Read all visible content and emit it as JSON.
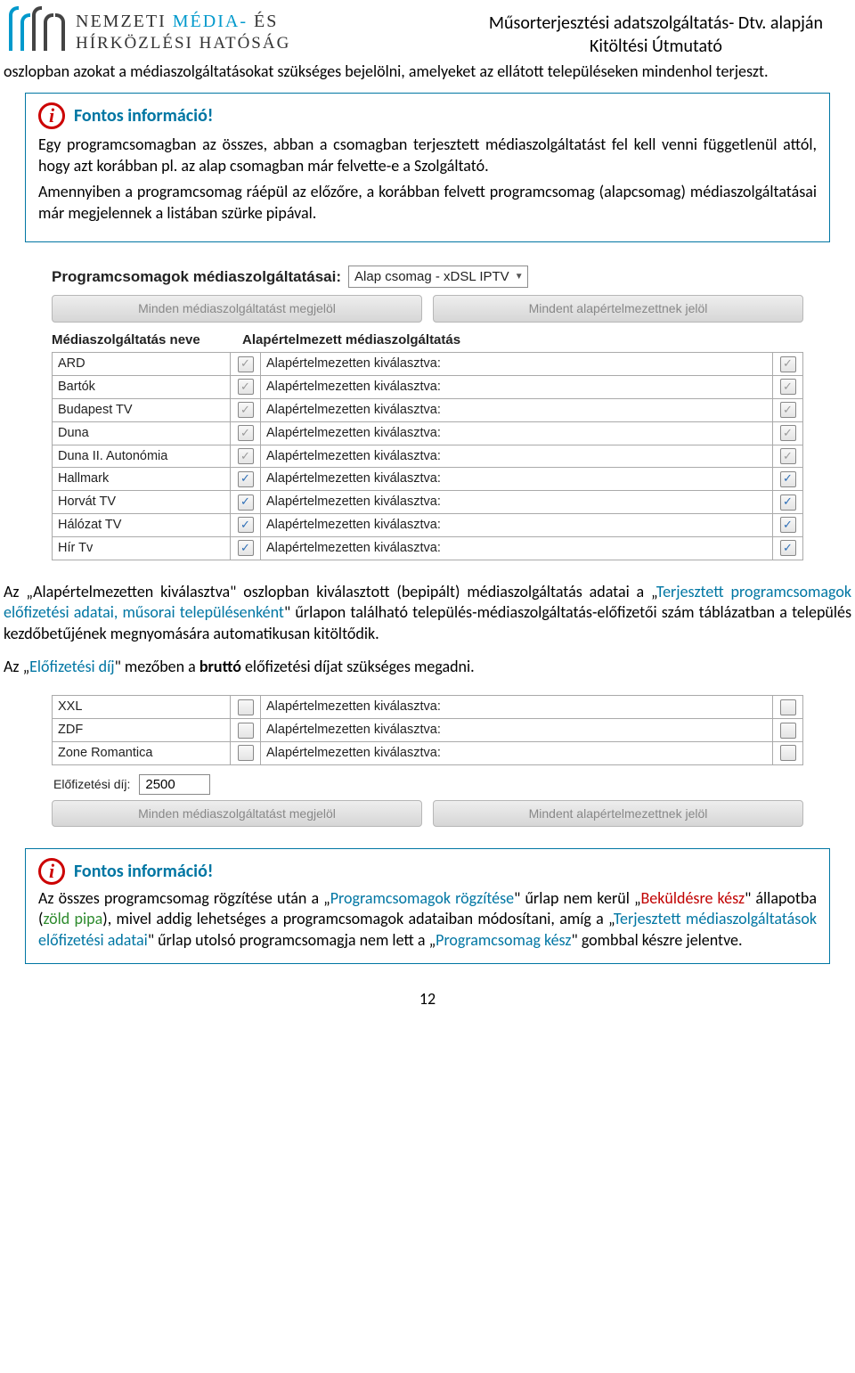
{
  "header": {
    "logo_line1_a": "NEMZETI",
    "logo_line1_b": "MÉDIA-",
    "logo_line1_c": "ÉS",
    "logo_line2": "HÍRKÖZLÉSI HATÓSÁG",
    "title1": "Műsorterjesztési adatszolgáltatás- Dtv. alapján",
    "title2": "Kitöltési Útmutató"
  },
  "intro_paragraph": "oszlopban azokat a médiaszolgáltatásokat szükséges bejelölni, amelyeket az ellátott településeken mindenhol terjeszt.",
  "info1": {
    "title": "Fontos információ!",
    "p1": "Egy programcsomagban az összes, abban a csomagban terjesztett médiaszolgáltatást fel kell venni függetlenül attól, hogy azt korábban pl. az alap csomagban már felvette-e a Szolgáltató.",
    "p2": "Amennyiben a programcsomag ráépül az előzőre, a korábban felvett programcsomag (alapcsomag) médiaszolgáltatásai már megjelennek a listában szürke pipával."
  },
  "ui1": {
    "heading": "Programcsomagok médiaszolgáltatásai:",
    "select_value": "Alap csomag - xDSL IPTV",
    "tab_a": "Minden médiaszolgáltatást megjelöl",
    "tab_b": "Mindent alapértelmezettnek jelöl",
    "col_name": "Médiaszolgáltatás neve",
    "col_def": "Alapértelmezett médiaszolgáltatás",
    "row_label": "Alapértelmezetten kiválasztva:",
    "rows": [
      {
        "name": "ARD",
        "c1": "dim",
        "c2": "dim"
      },
      {
        "name": "Bartók",
        "c1": "dim",
        "c2": "dim"
      },
      {
        "name": "Budapest TV",
        "c1": "dim",
        "c2": "dim"
      },
      {
        "name": "Duna",
        "c1": "dim",
        "c2": "dim"
      },
      {
        "name": "Duna II. Autonómia",
        "c1": "dim",
        "c2": "dim"
      },
      {
        "name": "Hallmark",
        "c1": "on",
        "c2": "on"
      },
      {
        "name": "Horvát TV",
        "c1": "on",
        "c2": "on"
      },
      {
        "name": "Hálózat TV",
        "c1": "on",
        "c2": "on"
      },
      {
        "name": "Hír Tv",
        "c1": "on",
        "c2": "on"
      }
    ]
  },
  "mid_paragraph_parts": {
    "a": "Az „Alapértelmezetten kiválasztva\" oszlopban kiválasztott (bepipált) médiaszolgáltatás adatai a „",
    "b": "Terjesztett programcsomagok előfizetési adatai, műsorai településenként",
    "c": "\" űrlapon található település-médiaszolgáltatás-előfizetői szám táblázatban a település kezdőbetűjének megnyomására automatikusan kitöltődik."
  },
  "fee_sentence_parts": {
    "a": "Az „",
    "b": "Előfizetési díj",
    "c": "\" mezőben a ",
    "d": "bruttó",
    "e": " előfizetési díjat szükséges megadni."
  },
  "ui2": {
    "rows": [
      {
        "name": "XXL"
      },
      {
        "name": "ZDF"
      },
      {
        "name": "Zone Romantica"
      }
    ],
    "row_label": "Alapértelmezetten kiválasztva:",
    "fee_label": "Előfizetési díj:",
    "fee_value": "2500",
    "tab_a": "Minden médiaszolgáltatást megjelöl",
    "tab_b": "Mindent alapértelmezettnek jelöl"
  },
  "info2": {
    "title": "Fontos információ!",
    "a": "Az összes programcsomag rögzítése után a „",
    "b": "Programcsomagok rögzítése",
    "c": "\" űrlap nem kerül „",
    "d": "Beküldésre kész",
    "e": "\" állapotba (",
    "f": "zöld pipa",
    "g": "), mivel addig lehetséges a programcsomagok adataiban módosítani, amíg a „",
    "h": "Terjesztett médiaszolgáltatások előfizetési adatai",
    "i": "\" űrlap utolsó programcsomagja nem lett a „",
    "j": "Programcsomag kész",
    "k": "\" gombbal készre jelentve."
  },
  "page_number": "12"
}
